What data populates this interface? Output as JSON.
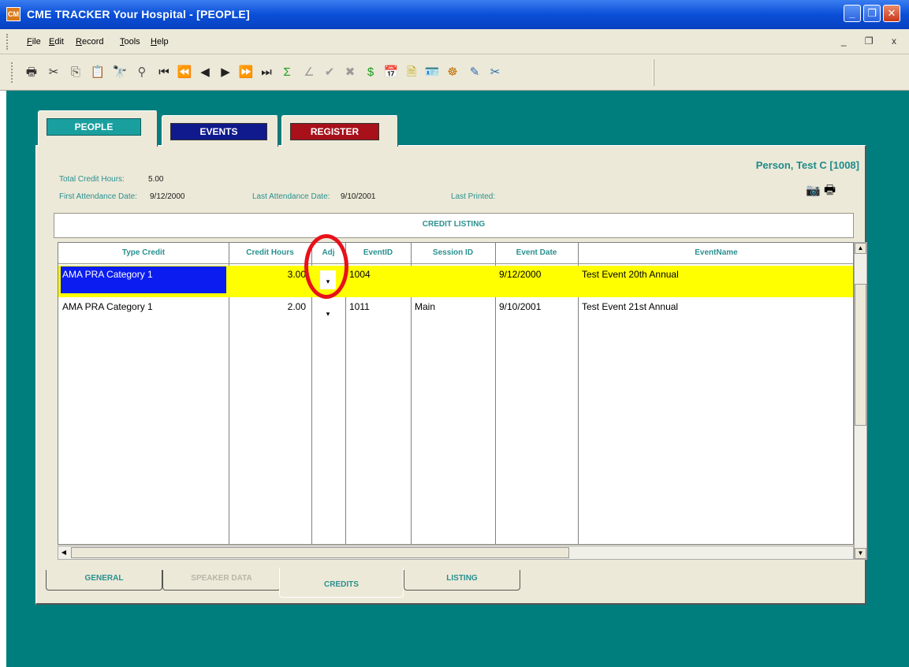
{
  "window": {
    "icon_text": "CM",
    "title": "CME TRACKER   Your Hospital - [PEOPLE]",
    "minimize": "_",
    "maximize": "❐",
    "close": "✕"
  },
  "menu": {
    "items": [
      {
        "key": "F",
        "rest": "ile"
      },
      {
        "key": "E",
        "rest": "dit"
      },
      {
        "key": "R",
        "rest": "ecord"
      },
      {
        "key": "T",
        "rest": "ools"
      },
      {
        "key": "H",
        "rest": "elp"
      }
    ],
    "mdi_controls": "_ ❐ x"
  },
  "toolbar": {
    "icons": [
      {
        "name": "print-icon",
        "glyph": "🖶",
        "color": "#333333"
      },
      {
        "name": "cut-icon",
        "glyph": "✂",
        "color": "#333333"
      },
      {
        "name": "copy-icon",
        "glyph": "⎘",
        "color": "#555555"
      },
      {
        "name": "paste-icon",
        "glyph": "📋",
        "color": "#555555"
      },
      {
        "name": "find-icon",
        "glyph": "🔭",
        "color": "#333333"
      },
      {
        "name": "find-replace-icon",
        "glyph": "⚲",
        "color": "#555555"
      },
      {
        "name": "first-record-icon",
        "glyph": "⏮",
        "color": "#222222"
      },
      {
        "name": "previous-page-icon",
        "glyph": "⏪",
        "color": "#222222"
      },
      {
        "name": "previous-record-icon",
        "glyph": "◀",
        "color": "#222222"
      },
      {
        "name": "next-record-icon",
        "glyph": "▶",
        "color": "#222222"
      },
      {
        "name": "next-page-icon",
        "glyph": "⏩",
        "color": "#222222"
      },
      {
        "name": "last-record-icon",
        "glyph": "⏭",
        "color": "#222222"
      },
      {
        "name": "sum-icon",
        "glyph": "Σ",
        "color": "#1a9a1a"
      },
      {
        "name": "angle-icon",
        "glyph": "∠",
        "color": "#9a9a9a"
      },
      {
        "name": "check-icon",
        "glyph": "✔",
        "color": "#9a9a9a"
      },
      {
        "name": "cancel-icon",
        "glyph": "✖",
        "color": "#9a9a9a"
      },
      {
        "name": "dollar-icon",
        "glyph": "$",
        "color": "#1a9a1a"
      },
      {
        "name": "calendar-icon",
        "glyph": "📅",
        "color": "#c02020"
      },
      {
        "name": "document-icon",
        "glyph": "🗎",
        "color": "#c0a000"
      },
      {
        "name": "id-card-icon",
        "glyph": "🪪",
        "color": "#444444"
      },
      {
        "name": "people-icon",
        "glyph": "☸",
        "color": "#c07000"
      },
      {
        "name": "chart-edit-icon",
        "glyph": "✎",
        "color": "#2a6ab0"
      },
      {
        "name": "scissors-tool-icon",
        "glyph": "✂",
        "color": "#2a6ab0"
      }
    ]
  },
  "top_tabs": {
    "people": "PEOPLE",
    "events": "EVENTS",
    "register": "REGISTER"
  },
  "summary": {
    "total_credit_hours_label": "Total Credit Hours:",
    "total_credit_hours_value": "5.00",
    "first_attendance_label": "First Attendance Date:",
    "first_attendance_value": "9/12/2000",
    "last_attendance_label": "Last Attendance Date:",
    "last_attendance_value": "9/10/2001",
    "last_printed_label": "Last Printed:",
    "person_name": "Person, Test C [1008]"
  },
  "credit_listing": {
    "title": "CREDIT LISTING",
    "columns": [
      "Type Credit",
      "Credit Hours",
      "Adj",
      "EventID",
      "Session ID",
      "Event Date",
      "EventName"
    ],
    "rows": [
      {
        "type_credit": "AMA PRA Category 1",
        "credit_hours": "3.00",
        "adj": "▾",
        "event_id": "1004",
        "session_id": "",
        "event_date": "9/12/2000",
        "event_name": "Test Event 20th Annual"
      },
      {
        "type_credit": "AMA PRA Category 1",
        "credit_hours": "2.00",
        "adj": "▾",
        "event_id": "1011",
        "session_id": "Main",
        "event_date": "9/10/2001",
        "event_name": "Test Event 21st Annual"
      }
    ]
  },
  "bottom_tabs": {
    "general": "GENERAL",
    "speaker_data": "SPEAKER DATA",
    "credits": "CREDITS",
    "listing": "LISTING"
  },
  "colors": {
    "titlebar": "#0a4fd8",
    "client_background": "#007e7e",
    "accent_teal": "#2a9090",
    "selected_row": "#ffff00",
    "selected_cell": "#0b1cf0",
    "highlight_circle": "#e8101a"
  }
}
